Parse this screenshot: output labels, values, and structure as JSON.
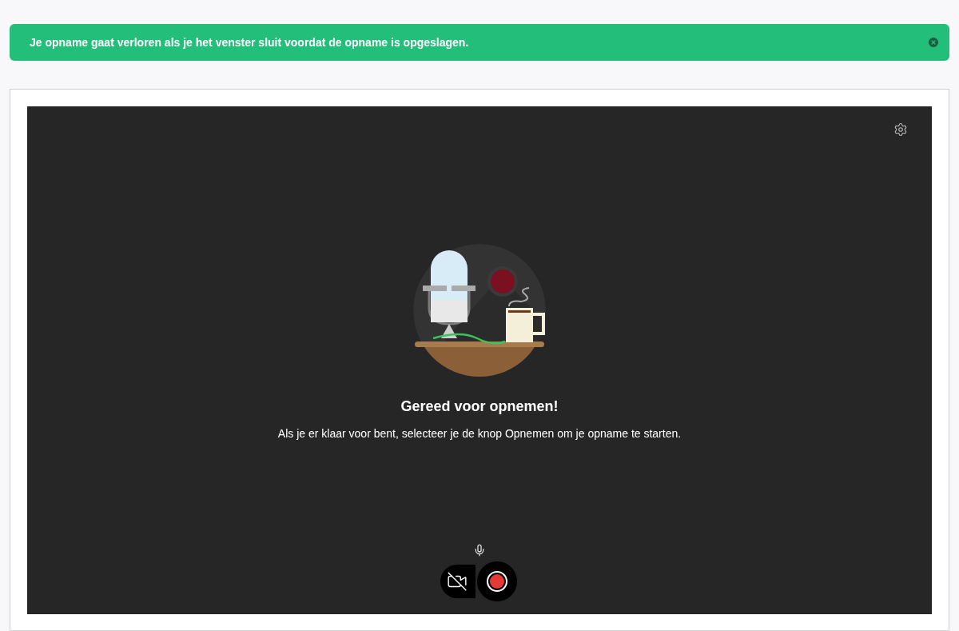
{
  "banner": {
    "message": "Je opname gaat verloren als je het venster sluit voordat de opname is opgeslagen."
  },
  "recorder": {
    "title": "Gereed voor opnemen!",
    "instructions": "Als je er klaar voor bent, selecteer je de knop Opnemen om je opname te starten.",
    "camera_on": false
  }
}
